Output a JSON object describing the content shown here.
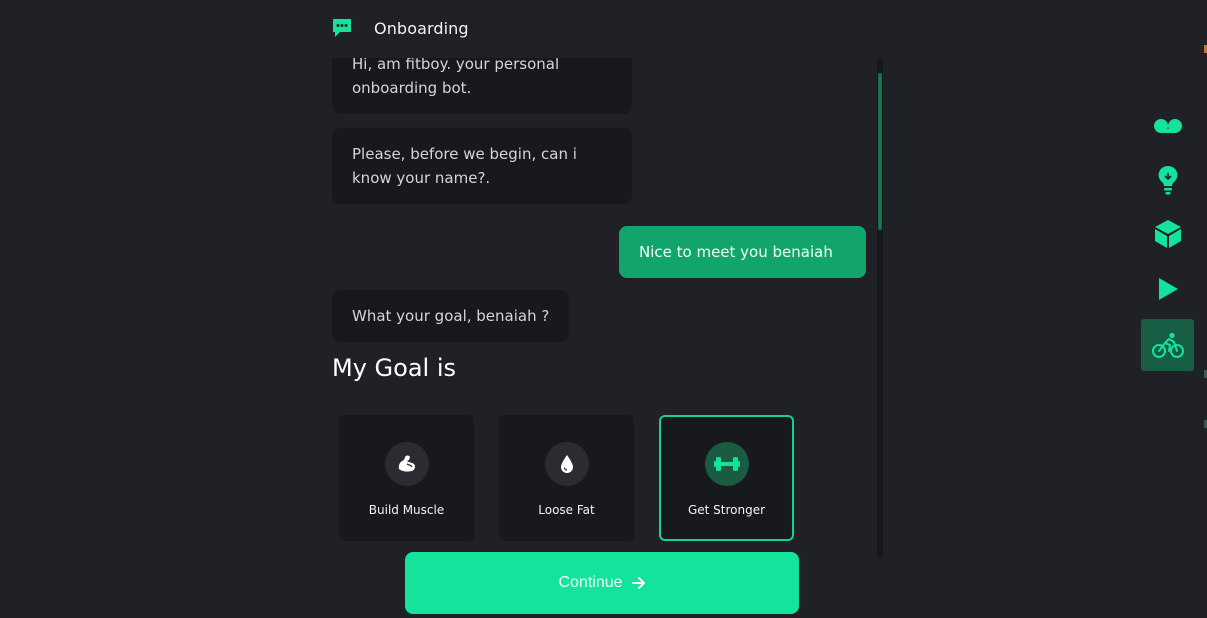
{
  "header": {
    "title": "Onboarding",
    "icon": "chat-bubble-icon"
  },
  "chat": {
    "messages": [
      {
        "from": "bot",
        "text": "Hi, am fitboy. your personal onboarding bot."
      },
      {
        "from": "bot",
        "text": "Please, before we begin, can i know your name?."
      },
      {
        "from": "user",
        "text": "Nice to meet you benaiah"
      },
      {
        "from": "bot",
        "text": "What your goal, benaiah ?"
      }
    ],
    "goal_heading": "My Goal is",
    "goals": [
      {
        "label": "Build Muscle",
        "icon": "flexed-arm-icon",
        "selected": false
      },
      {
        "label": "Loose Fat",
        "icon": "water-drop-icon",
        "selected": false
      },
      {
        "label": "Get Stronger",
        "icon": "dumbbell-icon",
        "selected": true
      }
    ]
  },
  "continue_button": {
    "label": "Continue",
    "icon": "arrow-right-icon"
  },
  "side_nav": {
    "items": [
      {
        "icon": "voicemail-icon",
        "active": false
      },
      {
        "icon": "lightbulb-icon",
        "active": false
      },
      {
        "icon": "cube-icon",
        "active": false
      },
      {
        "icon": "play-icon",
        "active": false
      },
      {
        "icon": "bicycle-icon",
        "active": true
      }
    ]
  },
  "colors": {
    "background": "#1f2126",
    "bubble_bot": "#18191d",
    "bubble_user": "#12a56b",
    "accent": "#13e39b",
    "active_nav": "#175e45"
  }
}
